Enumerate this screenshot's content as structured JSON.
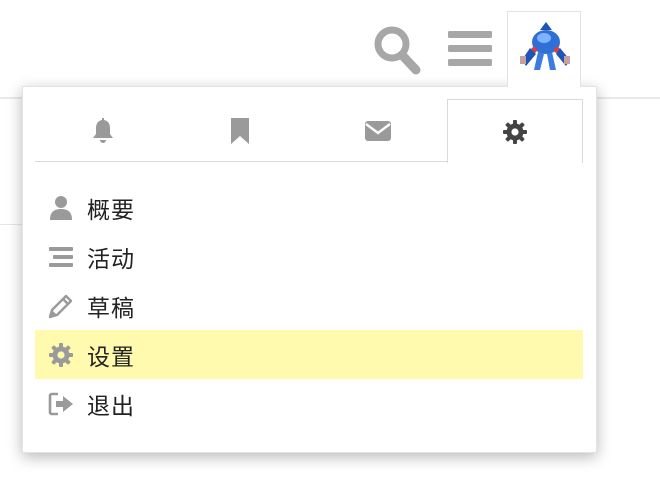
{
  "header": {
    "icons": [
      "search-icon",
      "hamburger-menu-icon"
    ],
    "avatar": "user-avatar-blue-robot"
  },
  "user_menu": {
    "tabs": [
      {
        "icon": "bell-icon",
        "selected": false
      },
      {
        "icon": "bookmark-icon",
        "selected": false
      },
      {
        "icon": "envelope-icon",
        "selected": false
      },
      {
        "icon": "gear-icon",
        "selected": true
      }
    ],
    "items": [
      {
        "label": "概要",
        "icon": "user-icon",
        "highlighted": false
      },
      {
        "label": "活动",
        "icon": "stream-icon",
        "highlighted": false
      },
      {
        "label": "草稿",
        "icon": "pencil-icon",
        "highlighted": false
      },
      {
        "label": "设置",
        "icon": "gear-icon",
        "highlighted": true
      },
      {
        "label": "退出",
        "icon": "sign-out-icon",
        "highlighted": false
      }
    ]
  },
  "colors": {
    "icon_gray": "#9a9a9a",
    "icon_dark": "#444444",
    "highlight": "#fffaad",
    "avatar_blue": "#2f6fd6"
  }
}
